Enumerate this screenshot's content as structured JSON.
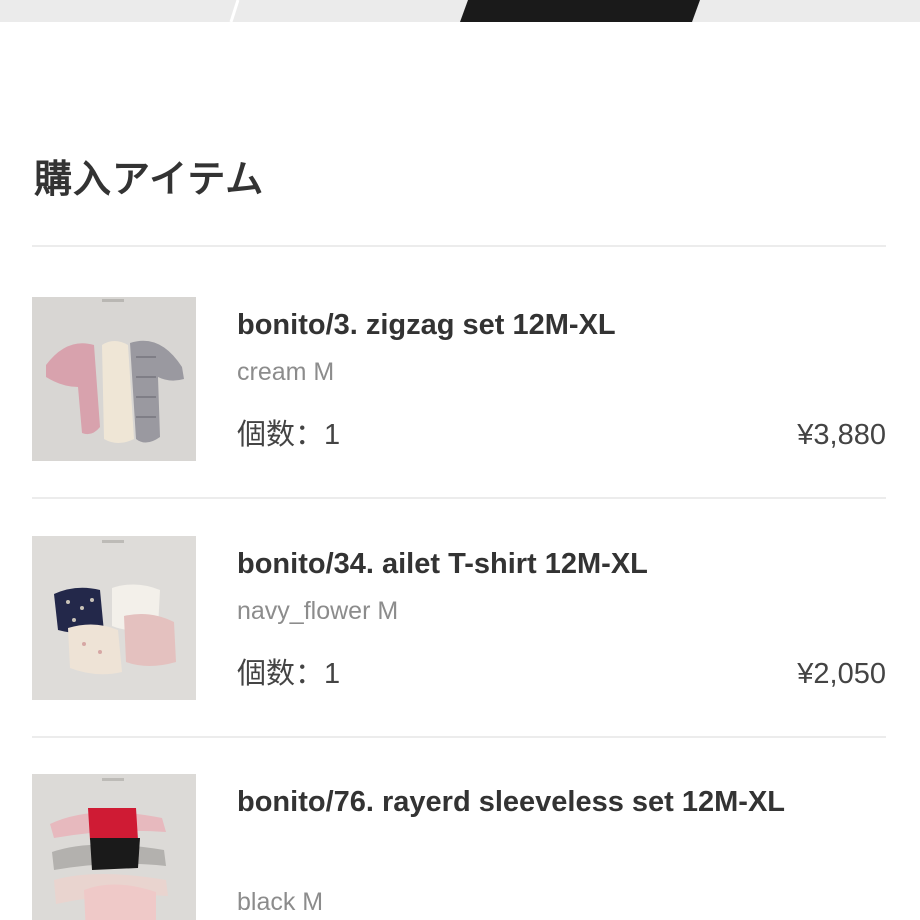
{
  "progress_steps": {
    "active_color": "#1a1a1a",
    "inactive_color": "#ebebeb"
  },
  "section": {
    "title": "購入アイテム"
  },
  "items": [
    {
      "name": "bonito/3. zigzag set 12M-XL",
      "variant": "cream M",
      "qty_label": "個数：1",
      "price": "¥3,880",
      "thumbnail_icon": "clothing-photo"
    },
    {
      "name": "bonito/34. ailet T-shirt 12M-XL",
      "variant": "navy_flower M",
      "qty_label": "個数：1",
      "price": "¥2,050",
      "thumbnail_icon": "clothing-photo"
    },
    {
      "name": "bonito/76. rayerd sleeveless set 12M-XL",
      "variant": "black M",
      "qty_label": "",
      "price": "",
      "thumbnail_icon": "clothing-photo"
    }
  ]
}
